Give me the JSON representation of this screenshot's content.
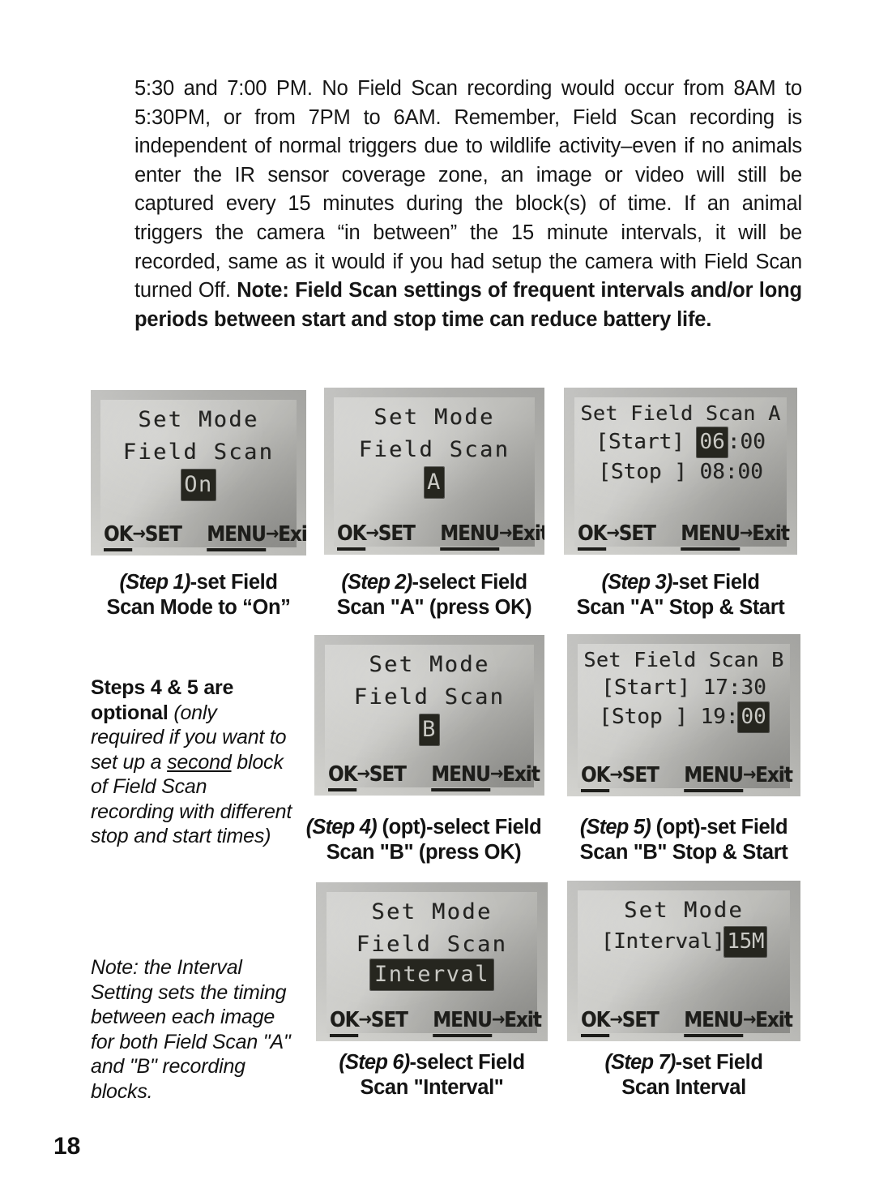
{
  "page": {
    "number": "18",
    "body_paragraph_part1": "5:30 and 7:00 PM. No Field Scan recording would occur from 8AM to 5:30PM, or from 7PM to 6AM. Remember, Field Scan recording is independent of normal triggers due to wildlife activity–even if no animals enter the IR sensor coverage zone, an image or video will still be captured every 15 minutes during the block(s) of time. If an animal triggers the camera “in between” the 15 minute intervals, it will be recorded, same as it would if you had setup the camera with Field Scan turned Off. ",
    "body_paragraph_bold": "Note: Field Scan settings of frequent intervals and/or long periods between start and stop time can reduce battery life."
  },
  "lcd_screens": [
    {
      "id": "step1",
      "line1": "Set Mode",
      "line2": "Field Scan",
      "line3_highlight": "On",
      "softkey_left_underline": "OK",
      "softkey_left_rest": "SET",
      "softkey_right_underline": "MENU",
      "softkey_right_rest": "Exit",
      "arrow": "→"
    },
    {
      "id": "step2",
      "line1": "Set Mode",
      "line2": "Field Scan",
      "line3_highlight": "A",
      "softkey_left_underline": "OK",
      "softkey_left_rest": "SET",
      "softkey_right_underline": "MENU",
      "softkey_right_rest": "Exit",
      "arrow": "→"
    },
    {
      "id": "step3",
      "line1": "Set Field Scan A",
      "start_label": "[Start]",
      "start_hours": "06",
      "start_minutes": ":00",
      "stop_label": "[Stop ]",
      "stop_time": "08:00",
      "softkey_left_underline": "OK",
      "softkey_left_rest": "SET",
      "softkey_right_underline": "MENU",
      "softkey_right_rest": "Exit",
      "arrow": "→"
    },
    {
      "id": "step4",
      "line1": "Set Mode",
      "line2": "Field Scan",
      "line3_highlight": "B",
      "softkey_left_underline": "OK",
      "softkey_left_rest": "SET",
      "softkey_right_underline": "MENU",
      "softkey_right_rest": "Exit",
      "arrow": "→"
    },
    {
      "id": "step5",
      "line1": "Set Field Scan B",
      "start_label": "[Start]",
      "start_time": "17:30",
      "stop_label": "[Stop ]",
      "stop_hours": "19:",
      "stop_minutes": "00",
      "softkey_left_underline": "OK",
      "softkey_left_rest": "SET",
      "softkey_right_underline": "MENU",
      "softkey_right_rest": "Exit",
      "arrow": "→"
    },
    {
      "id": "step6",
      "line1": "Set Mode",
      "line2": "Field Scan",
      "line3_highlight": "Interval",
      "softkey_left_underline": "OK",
      "softkey_left_rest": "SET",
      "softkey_right_underline": "MENU",
      "softkey_right_rest": "Exit",
      "arrow": "→"
    },
    {
      "id": "step7",
      "line1": "Set Mode",
      "interval_label": "[Interval]",
      "interval_value": "15M",
      "softkey_left_underline": "OK",
      "softkey_left_rest": "SET",
      "softkey_right_underline": "MENU",
      "softkey_right_rest": "Exit",
      "arrow": "→"
    }
  ],
  "captions": {
    "step1": {
      "step": "(Step 1)",
      "rest": "-set Field",
      "line2": "Scan Mode to “On”"
    },
    "step2": {
      "step": "(Step 2)",
      "rest": "-select Field",
      "line2": "Scan \"A\" (press OK)"
    },
    "step3": {
      "step": "(Step 3)",
      "rest": "-set Field",
      "line2": "Scan \"A\" Stop & Start"
    },
    "step4": {
      "step": "(Step 4)",
      "rest": " (opt)-select Field",
      "line2": "Scan \"B\" (press OK)"
    },
    "step5": {
      "step": "(Step 5)",
      "rest": " (opt)-set Field",
      "line2": "Scan \"B\" Stop & Start"
    },
    "step6": {
      "step": "(Step 6)",
      "rest": "-select Field",
      "line2": "Scan \"Interval\""
    },
    "step7": {
      "step": "(Step 7)",
      "rest": "-set Field",
      "line2": "Scan Interval"
    }
  },
  "sidenotes": {
    "optional_bold": "Steps 4 & 5 are optional",
    "optional_italic_a": " (only required if you want to set up a ",
    "optional_underlined": "second",
    "optional_italic_b": " block of Field Scan recording with different stop and start times)",
    "interval_note": "Note: the Interval Setting sets the timing between each image for both Field Scan \"A\" and \"B\" recording blocks."
  }
}
